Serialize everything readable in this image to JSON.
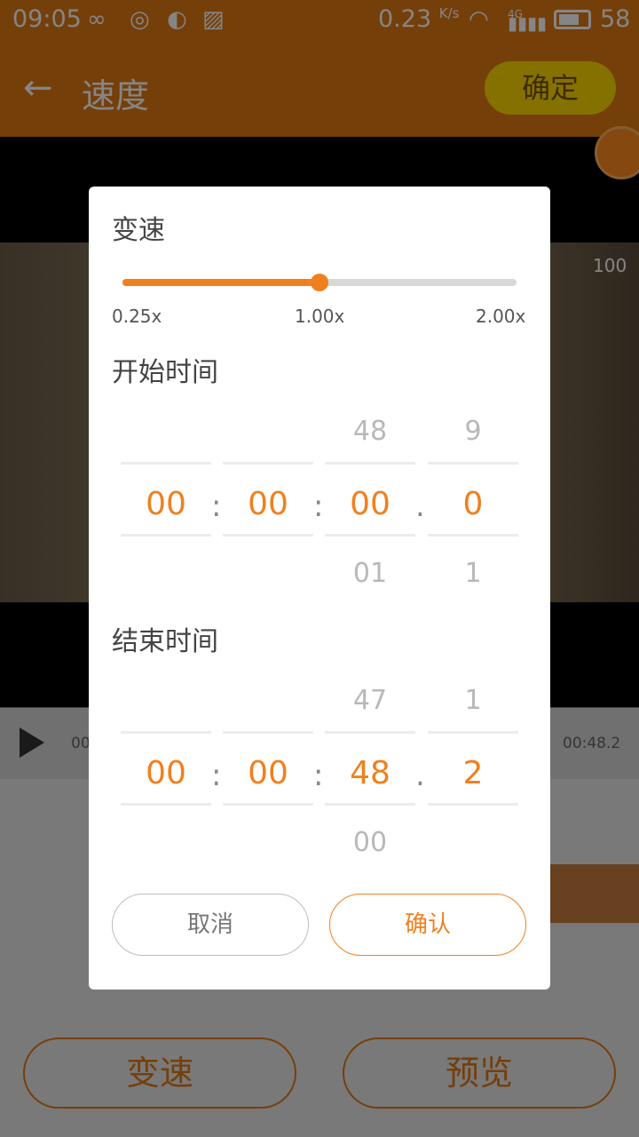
{
  "status_bar": {
    "time": "09:05",
    "net_speed": "0.23",
    "net_unit": "K/s",
    "signal_label": "4G",
    "battery": "58"
  },
  "app_bar": {
    "back_icon": "arrow-left-icon",
    "title": "速度",
    "confirm_label": "确定"
  },
  "player": {
    "time_start": "00",
    "time_end": "00:48.2"
  },
  "video_hud": {
    "score": "100"
  },
  "bottom_buttons": {
    "speed_label": "变速",
    "preview_label": "预览"
  },
  "dialog": {
    "speed_title": "变速",
    "slider": {
      "min_label": "0.25x",
      "mid_label": "1.00x",
      "max_label": "2.00x",
      "level_fraction": 0.5
    },
    "start_title": "开始时间",
    "start_picker": {
      "columns": [
        {
          "above": "",
          "selected": "00",
          "below": ""
        },
        {
          "above": "",
          "selected": "00",
          "below": ""
        },
        {
          "above": "48",
          "selected": "00",
          "below": "01"
        },
        {
          "above": "9",
          "selected": "0",
          "below": "1"
        }
      ]
    },
    "end_title": "结束时间",
    "end_picker": {
      "columns": [
        {
          "above": "",
          "selected": "00",
          "below": ""
        },
        {
          "above": "",
          "selected": "00",
          "below": ""
        },
        {
          "above": "47",
          "selected": "48",
          "below": "00"
        },
        {
          "above": "1",
          "selected": "2",
          "below": ""
        }
      ]
    },
    "separators": [
      ":",
      ":",
      "."
    ],
    "cancel_label": "取消",
    "ok_label": "确认"
  },
  "colors": {
    "accent": "#f0801e",
    "appbar": "#e07a14"
  }
}
